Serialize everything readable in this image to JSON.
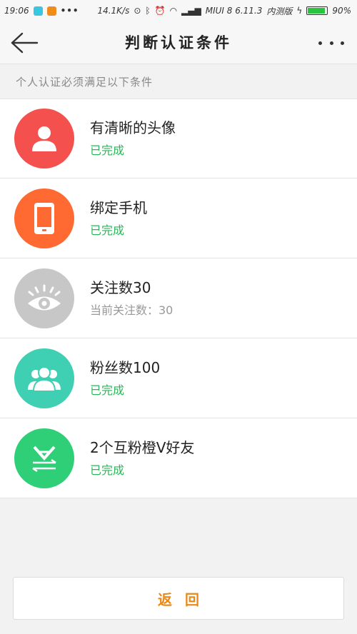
{
  "status_bar": {
    "time": "19:06",
    "speed": "14.1K/s",
    "carrier": "MIUI 8  6.11.3",
    "edition": "内测版",
    "battery": "90%",
    "battery_level": 0.9,
    "more_glyph": "•••"
  },
  "header": {
    "title": "判断认证条件"
  },
  "section": {
    "label": "个人认证必须满足以下条件"
  },
  "conditions": [
    {
      "title": "有清晰的头像",
      "status": "已完成",
      "icon": "avatar-icon",
      "color": "#f4504e",
      "status_color": "#2bb55a"
    },
    {
      "title": "绑定手机",
      "status": "已完成",
      "icon": "phone-icon",
      "color": "#ff6a32",
      "status_color": "#2bb55a"
    },
    {
      "title": "关注数30",
      "status": "当前关注数：30",
      "icon": "eye-icon",
      "color": "#c7c7c7",
      "status_color": "#999999"
    },
    {
      "title": "粉丝数100",
      "status": "已完成",
      "icon": "fans-icon",
      "color": "#3fcfb3",
      "status_color": "#2bb55a"
    },
    {
      "title": "2个互粉橙V好友",
      "status": "已完成",
      "icon": "mutual-v-icon",
      "color": "#2fcf78",
      "status_color": "#2bb55a"
    }
  ],
  "footer": {
    "back_label": "返回",
    "accent_color": "#e9891b"
  }
}
